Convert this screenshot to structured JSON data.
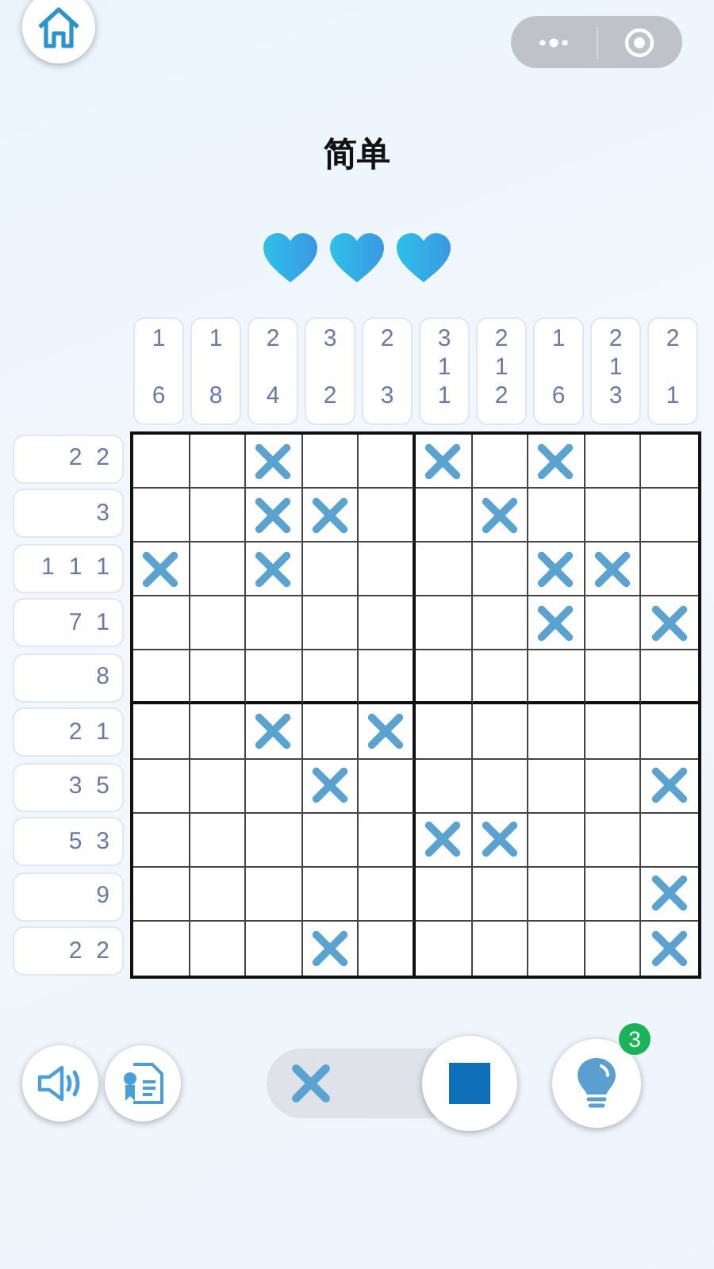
{
  "title": "简单",
  "lives": [
    {
      "filled": true
    },
    {
      "filled": true
    },
    {
      "filled": true
    }
  ],
  "column_clues": [
    [
      "1",
      "6"
    ],
    [
      "1",
      "8"
    ],
    [
      "2",
      "4"
    ],
    [
      "3",
      "2"
    ],
    [
      "2",
      "3"
    ],
    [
      "3",
      "1",
      "1"
    ],
    [
      "2",
      "1",
      "2"
    ],
    [
      "1",
      "6"
    ],
    [
      "2",
      "1",
      "3"
    ],
    [
      "2",
      "1"
    ]
  ],
  "row_clues": [
    [
      "2",
      "2"
    ],
    [
      "3"
    ],
    [
      "1",
      "1",
      "1"
    ],
    [
      "7",
      "1"
    ],
    [
      "8"
    ],
    [
      "2",
      "1"
    ],
    [
      "3",
      "5"
    ],
    [
      "5",
      "3"
    ],
    [
      "9"
    ],
    [
      "2",
      "2"
    ]
  ],
  "grid": [
    {
      "cells": [
        {
          "crossed": false
        },
        {
          "crossed": false
        },
        {
          "crossed": true
        },
        {
          "crossed": false
        },
        {
          "crossed": false
        },
        {
          "crossed": true
        },
        {
          "crossed": false
        },
        {
          "crossed": true
        },
        {
          "crossed": false
        },
        {
          "crossed": false
        }
      ]
    },
    {
      "cells": [
        {
          "crossed": false
        },
        {
          "crossed": false
        },
        {
          "crossed": true
        },
        {
          "crossed": true
        },
        {
          "crossed": false
        },
        {
          "crossed": false
        },
        {
          "crossed": true
        },
        {
          "crossed": false
        },
        {
          "crossed": false
        },
        {
          "crossed": false
        }
      ]
    },
    {
      "cells": [
        {
          "crossed": true
        },
        {
          "crossed": false
        },
        {
          "crossed": true
        },
        {
          "crossed": false
        },
        {
          "crossed": false
        },
        {
          "crossed": false
        },
        {
          "crossed": false
        },
        {
          "crossed": true
        },
        {
          "crossed": true
        },
        {
          "crossed": false
        }
      ]
    },
    {
      "cells": [
        {
          "crossed": false
        },
        {
          "crossed": false
        },
        {
          "crossed": false
        },
        {
          "crossed": false
        },
        {
          "crossed": false
        },
        {
          "crossed": false
        },
        {
          "crossed": false
        },
        {
          "crossed": true
        },
        {
          "crossed": false
        },
        {
          "crossed": true
        }
      ]
    },
    {
      "cells": [
        {
          "crossed": false
        },
        {
          "crossed": false
        },
        {
          "crossed": false
        },
        {
          "crossed": false
        },
        {
          "crossed": false
        },
        {
          "crossed": false
        },
        {
          "crossed": false
        },
        {
          "crossed": false
        },
        {
          "crossed": false
        },
        {
          "crossed": false
        }
      ]
    },
    {
      "cells": [
        {
          "crossed": false
        },
        {
          "crossed": false
        },
        {
          "crossed": true
        },
        {
          "crossed": false
        },
        {
          "crossed": true
        },
        {
          "crossed": false
        },
        {
          "crossed": false
        },
        {
          "crossed": false
        },
        {
          "crossed": false
        },
        {
          "crossed": false
        }
      ]
    },
    {
      "cells": [
        {
          "crossed": false
        },
        {
          "crossed": false
        },
        {
          "crossed": false
        },
        {
          "crossed": true
        },
        {
          "crossed": false
        },
        {
          "crossed": false
        },
        {
          "crossed": false
        },
        {
          "crossed": false
        },
        {
          "crossed": false
        },
        {
          "crossed": true
        }
      ]
    },
    {
      "cells": [
        {
          "crossed": false
        },
        {
          "crossed": false
        },
        {
          "crossed": false
        },
        {
          "crossed": false
        },
        {
          "crossed": false
        },
        {
          "crossed": true
        },
        {
          "crossed": true
        },
        {
          "crossed": false
        },
        {
          "crossed": false
        },
        {
          "crossed": false
        }
      ]
    },
    {
      "cells": [
        {
          "crossed": false
        },
        {
          "crossed": false
        },
        {
          "crossed": false
        },
        {
          "crossed": false
        },
        {
          "crossed": false
        },
        {
          "crossed": false
        },
        {
          "crossed": false
        },
        {
          "crossed": false
        },
        {
          "crossed": false
        },
        {
          "crossed": true
        }
      ]
    },
    {
      "cells": [
        {
          "crossed": false
        },
        {
          "crossed": false
        },
        {
          "crossed": false
        },
        {
          "crossed": true
        },
        {
          "crossed": false
        },
        {
          "crossed": false
        },
        {
          "crossed": false
        },
        {
          "crossed": false
        },
        {
          "crossed": false
        },
        {
          "crossed": true
        }
      ]
    }
  ],
  "mode_toggle": {
    "options": [
      {
        "kind": "cross",
        "selected": false
      },
      {
        "kind": "fill",
        "selected": true
      }
    ]
  },
  "hint": {
    "badge": "3"
  }
}
